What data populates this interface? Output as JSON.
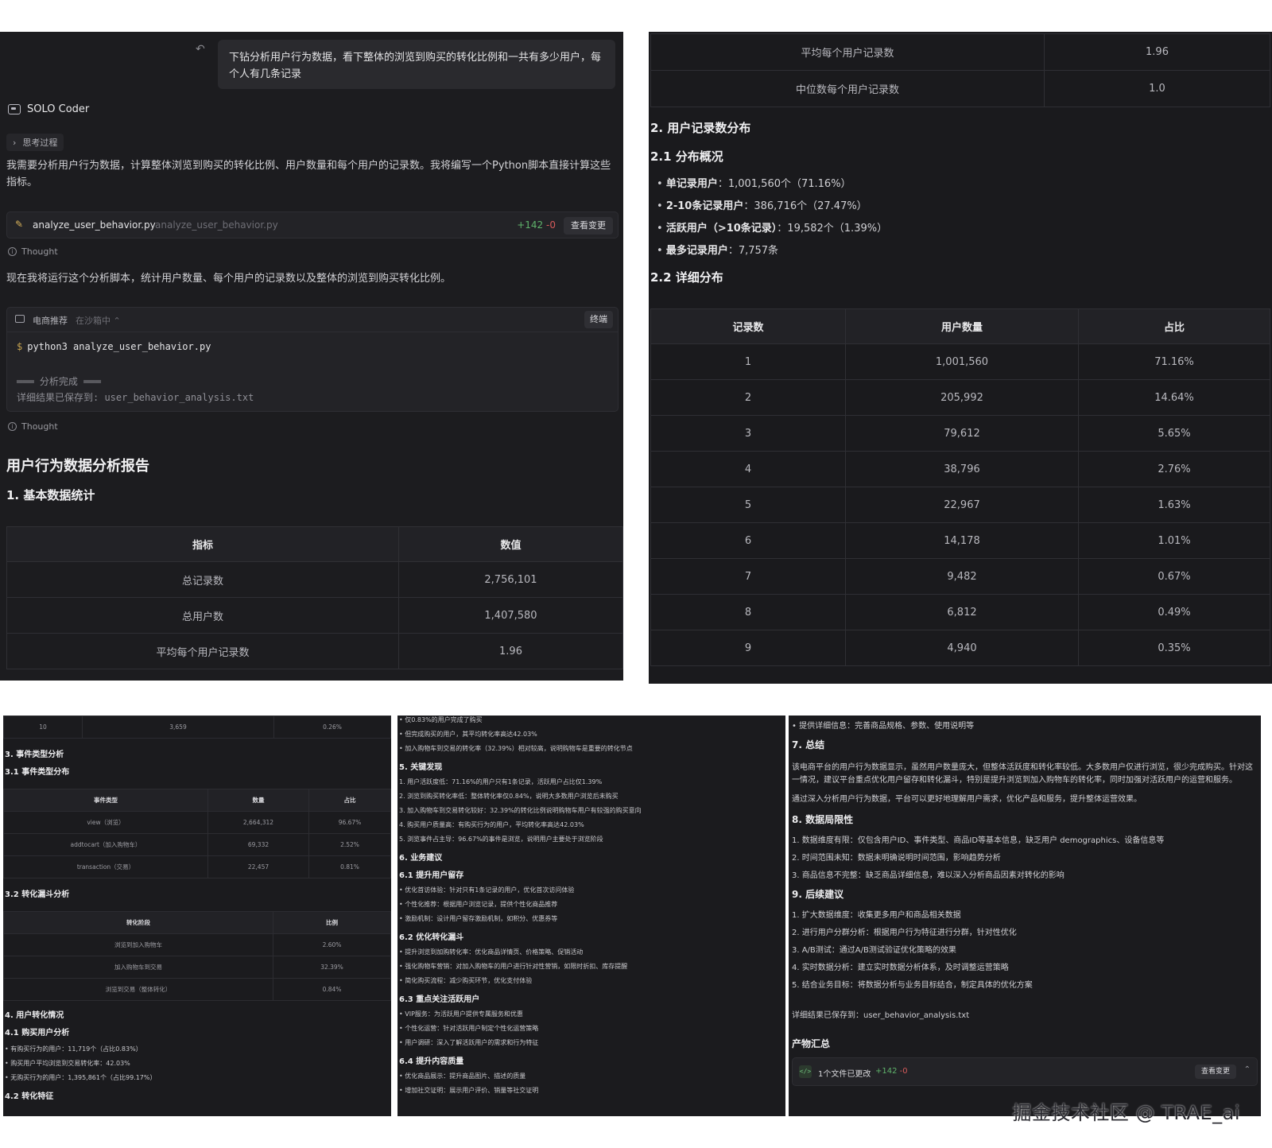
{
  "p1": {
    "user_message": "下钻分析用户行为数据，看下整体的浏览到购买的转化比例和一共有多少用户，每个人有几条记录",
    "agent_name": "SOLO Coder",
    "thinking_label": "思考过程",
    "intro": "我需要分析用户行为数据，计算整体浏览到购买的转化比例、用户数量和每个用户的记录数。我将编写一个Python脚本直接计算这些指标。",
    "file_card": {
      "name": "analyze_user_behavior.py",
      "path": "analyze_user_behavior.py",
      "added": "+142",
      "removed": "-0",
      "button": "查看变更"
    },
    "thought1": "Thought",
    "run_text": "现在我将运行这个分析脚本，统计用户数量、每个用户的记录数以及整体的浏览到购买转化比例。",
    "terminal": {
      "name": "电商推荐",
      "state": "在沙箱中 ⌃",
      "button": "终端",
      "command": "python3 analyze_user_behavior.py",
      "out1": "═══ 分析完成 ═══",
      "out2": "详细结果已保存到: user_behavior_analysis.txt"
    },
    "thought2": "Thought",
    "report_title": "用户行为数据分析报告",
    "section1": "1. 基本数据统计",
    "table_headers": [
      "指标",
      "数值"
    ],
    "table_rows": [
      [
        "总记录数",
        "2,756,101"
      ],
      [
        "总用户数",
        "1,407,580"
      ],
      [
        "平均每个用户记录数",
        "1.96"
      ]
    ]
  },
  "p2": {
    "top_rows": [
      [
        "平均每个用户记录数",
        "1.96"
      ],
      [
        "中位数每个用户记录数",
        "1.0"
      ]
    ],
    "section2": "2. 用户记录数分布",
    "section21": "2.1 分布概况",
    "bullets": [
      {
        "label": "单记录用户",
        "value": "：1,001,560个（71.16%）"
      },
      {
        "label": "2-10条记录用户",
        "value": "：386,716个（27.47%）"
      },
      {
        "label": "活跃用户（>10条记录）",
        "value": "：19,582个（1.39%）"
      },
      {
        "label": "最多记录用户",
        "value": "：7,757条"
      }
    ],
    "section22": "2.2 详细分布",
    "dist_headers": [
      "记录数",
      "用户数量",
      "占比"
    ],
    "dist_rows": [
      [
        "1",
        "1,001,560",
        "71.16%"
      ],
      [
        "2",
        "205,992",
        "14.64%"
      ],
      [
        "3",
        "79,612",
        "5.65%"
      ],
      [
        "4",
        "38,796",
        "2.76%"
      ],
      [
        "5",
        "22,967",
        "1.63%"
      ],
      [
        "6",
        "14,178",
        "1.01%"
      ],
      [
        "7",
        "9,482",
        "0.67%"
      ],
      [
        "8",
        "6,812",
        "0.49%"
      ],
      [
        "9",
        "4,940",
        "0.35%"
      ]
    ]
  },
  "p3": {
    "top_row": [
      "10",
      "3,659",
      "0.26%"
    ],
    "s3": "3. 事件类型分析",
    "s31": "3.1 事件类型分布",
    "event_headers": [
      "事件类型",
      "数量",
      "占比"
    ],
    "event_rows": [
      [
        "view（浏览）",
        "2,664,312",
        "96.67%"
      ],
      [
        "addtocart（加入购物车）",
        "69,332",
        "2.52%"
      ],
      [
        "transaction（交易）",
        "22,457",
        "0.81%"
      ]
    ],
    "s32": "3.2 转化漏斗分析",
    "funnel_headers": [
      "转化阶段",
      "比例"
    ],
    "funnel_rows": [
      [
        "浏览到加入购物车",
        "2.60%"
      ],
      [
        "加入购物车到交易",
        "32.39%"
      ],
      [
        "浏览到交易（整体转化）",
        "0.84%"
      ]
    ],
    "s4": "4. 用户转化情况",
    "s41": "4.1 购买用户分析",
    "buy_items": [
      "有购买行为的用户：11,719个（占比0.83%）",
      "购买用户平均浏览到交易转化率：42.03%",
      "无购买行为的用户：1,395,861个（占比99.17%）"
    ],
    "s42": "4.2 转化特征"
  },
  "p4": {
    "lines_top": [
      "仅0.83%的用户完成了购买",
      "但完成购买的用户，其平均转化率高达42.03%",
      "加入购物车到交易的转化率（32.39%）相对较高，说明购物车是重要的转化节点"
    ],
    "s5": "5. 关键发现",
    "findings": [
      "1. 用户活跃度低：71.16%的用户只有1条记录，活跃用户占比仅1.39%",
      "2. 浏览到购买转化率低：整体转化率仅0.84%，说明大多数用户浏览后未购买",
      "3. 加入购物车到交易转化较好：32.39%的转化比例说明购物车用户有较强的购买意向",
      "4. 购买用户质量高：有购买行为的用户，平均转化率高达42.03%",
      "5. 浏览事件占主导：96.67%的事件是浏览，说明用户主要处于浏览阶段"
    ],
    "s6": "6. 业务建议",
    "s61": "6.1 提升用户留存",
    "s61_items": [
      "优化首访体验：针对只有1条记录的用户，优化首次访问体验",
      "个性化推荐：根据用户浏览记录，提供个性化商品推荐",
      "激励机制：设计用户留存激励机制，如积分、优惠券等"
    ],
    "s62": "6.2 优化转化漏斗",
    "s62_items": [
      "提升浏览到加购转化率：优化商品详情页、价格策略、促销活动",
      "强化购物车营销：对加入购物车的用户进行针对性营销，如限时折扣、库存提醒",
      "简化购买流程：减少购买环节，优化支付体验"
    ],
    "s63": "6.3 重点关注活跃用户",
    "s63_items": [
      "VIP服务：为活跃用户提供专属服务和优惠",
      "个性化运营：针对活跃用户制定个性化运营策略",
      "用户调研：深入了解活跃用户的需求和行为特征"
    ],
    "s64": "6.4 提升内容质量",
    "s64_items": [
      "优化商品展示：提升商品图片、描述的质量",
      "增加社交证明：展示用户评价、销量等社交证明"
    ]
  },
  "p5": {
    "top_item": "提供详细信息：完善商品规格、参数、使用说明等",
    "s7": "7. 总结",
    "summary1": "该电商平台的用户行为数据显示，虽然用户数量庞大，但整体活跃度和转化率较低。大多数用户仅进行浏览，很少完成购买。针对这",
    "summary2": "一情况，建议平台重点优化用户留存和转化漏斗，特别是提升浏览到加入购物车的转化率，同时加强对活跃用户的运营和服务。",
    "summary3": "通过深入分析用户行为数据，平台可以更好地理解用户需求，优化产品和服务，提升整体运营效果。",
    "s8": "8. 数据局限性",
    "limits": [
      "1. 数据维度有限：仅包含用户ID、事件类型、商品ID等基本信息，缺乏用户 demographics、设备信息等",
      "2. 时间范围未知：数据未明确说明时间范围，影响趋势分析",
      "3. 商品信息不完整：缺乏商品详细信息，难以深入分析商品因素对转化的影响"
    ],
    "s9": "9. 后续建议",
    "next": [
      "1. 扩大数据维度：收集更多用户和商品相关数据",
      "2. 进行用户分群分析：根据用户行为特征进行分群，针对性优化",
      "3. A/B测试：通过A/B测试验证优化策略的效果",
      "4. 实时数据分析：建立实时数据分析体系，及时调整运营策略",
      "5. 结合业务目标：将数据分析与业务目标结合，制定具体的优化方案"
    ],
    "saved": "详细结果已保存到：user_behavior_analysis.txt",
    "artifacts": "产物汇总",
    "changed": "1个文件已更改",
    "added": "+142",
    "removed": "-0",
    "view_btn": "查看变更"
  },
  "watermark": "掘金技术社区 @ TRAE_ai"
}
